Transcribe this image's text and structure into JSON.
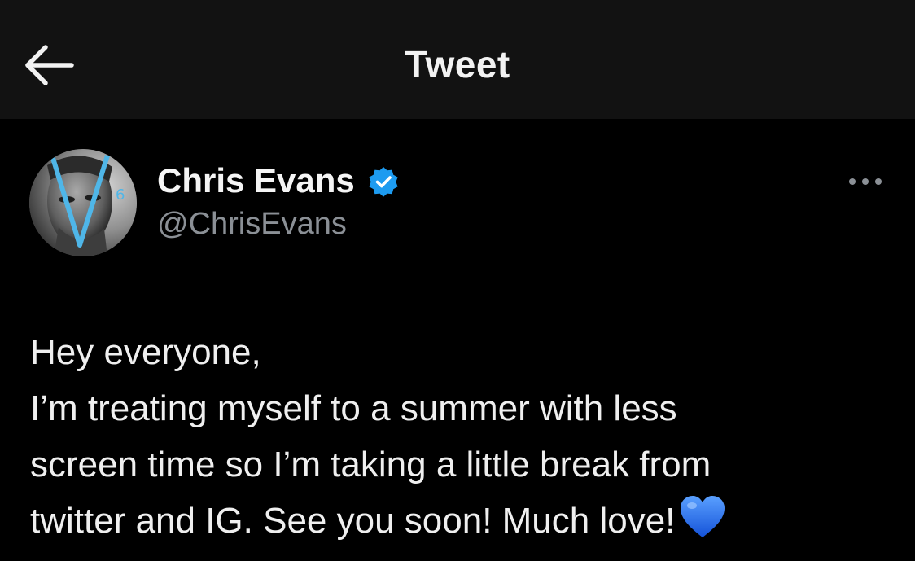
{
  "header": {
    "title": "Tweet",
    "back_icon": "arrow-left-icon"
  },
  "author": {
    "display_name": "Chris Evans",
    "handle": "@ChrisEvans",
    "verified_icon": "verified-badge-icon",
    "avatar_icon": "avatar-photo"
  },
  "menu": {
    "more_icon": "more-options-icon"
  },
  "tweet": {
    "lines": [
      "Hey everyone,",
      "I’m treating myself to a summer with less",
      "screen time so I’m taking a little break from",
      "twitter and IG. See you soon! Much love!"
    ],
    "emoji_icon": "blue-heart-icon"
  },
  "colors": {
    "background": "#000000",
    "header_background": "#121212",
    "primary_text": "#efefef",
    "secondary_text": "#8b9096",
    "verified_blue": "#1d9bf0",
    "heart_blue": "#1f6fe5"
  }
}
